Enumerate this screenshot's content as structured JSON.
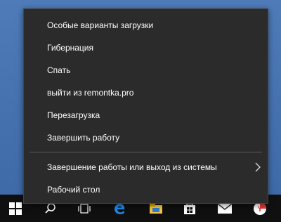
{
  "menu": {
    "items": [
      {
        "label": "Особые варианты загрузки"
      },
      {
        "label": "Гибернация"
      },
      {
        "label": "Спать"
      },
      {
        "label": "выйти из remontka.pro"
      },
      {
        "label": "Перезагрузка"
      },
      {
        "label": "Завершить работу"
      }
    ],
    "submenu_item": {
      "label": "Завершение работы или выход из системы",
      "icon": "chevron-right-icon"
    },
    "desktop_item": {
      "label": "Рабочий стол"
    }
  },
  "taskbar": {
    "icons": [
      "start-icon",
      "search-icon",
      "task-view-icon",
      "edge-icon",
      "file-explorer-icon",
      "store-icon",
      "mail-icon",
      "yandex-browser-icon"
    ]
  },
  "colors": {
    "menu_bg": "#2b2b2b",
    "taskbar_bg": "#101010",
    "desktop_bg": "#3f6aa6",
    "text": "#ffffff"
  }
}
